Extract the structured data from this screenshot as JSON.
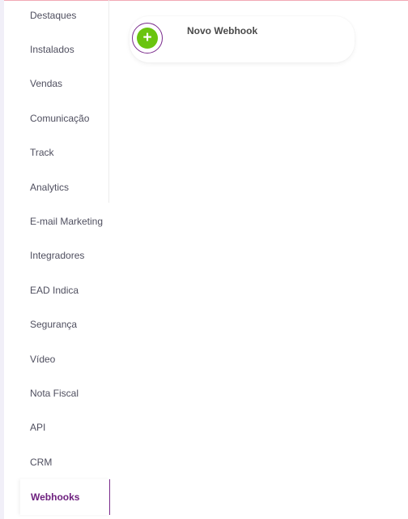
{
  "sidebar": {
    "items": [
      {
        "label": "Destaques"
      },
      {
        "label": "Instalados"
      },
      {
        "label": "Vendas"
      },
      {
        "label": "Comunicação"
      },
      {
        "label": "Track"
      },
      {
        "label": "Analytics"
      },
      {
        "label": "E-mail Marketing"
      },
      {
        "label": "Integradores"
      },
      {
        "label": "EAD Indica"
      },
      {
        "label": "Segurança"
      },
      {
        "label": "Vídeo"
      },
      {
        "label": "Nota Fiscal"
      },
      {
        "label": "API"
      },
      {
        "label": "CRM"
      },
      {
        "label": "Webhooks"
      }
    ],
    "active_label": "Webhooks"
  },
  "main": {
    "new_webhook": {
      "label": "Novo Webhook",
      "icon": "plus-icon",
      "icon_glyph": "+"
    }
  },
  "colors": {
    "accent": "#7a2b8c",
    "add_green": "#6ac40f",
    "active_text": "#6d1f7e",
    "menu_text": "#4f4f5f",
    "top_line": "#f2a9b5"
  }
}
